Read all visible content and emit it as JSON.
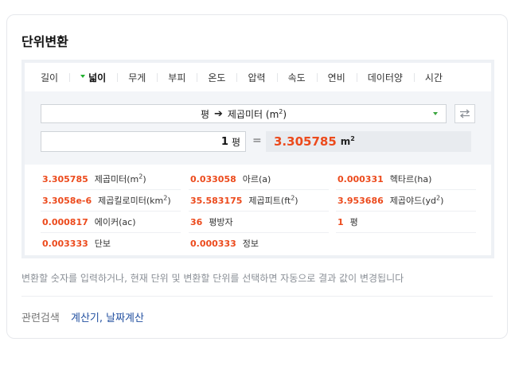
{
  "title": "단위변환",
  "tabs": [
    {
      "label": "길이"
    },
    {
      "label": "넓이",
      "active": true
    },
    {
      "label": "무게"
    },
    {
      "label": "부피"
    },
    {
      "label": "온도"
    },
    {
      "label": "압력"
    },
    {
      "label": "속도"
    },
    {
      "label": "연비"
    },
    {
      "label": "데이터양"
    },
    {
      "label": "시간"
    }
  ],
  "converter": {
    "from_unit": "평",
    "arrow": "➔",
    "to_unit_text": "제곱미터 (m",
    "to_unit_sup": "2",
    "to_unit_close": ")",
    "input_value": "1",
    "input_unit": "평",
    "equals": "=",
    "result_value": "3.305785",
    "result_unit": "m",
    "result_unit_sup": "2"
  },
  "results": [
    {
      "value": "3.305785",
      "name": "제곱미터(m",
      "sup": "2",
      "close": ")"
    },
    {
      "value": "0.033058",
      "name": "아르(a)"
    },
    {
      "value": "0.000331",
      "name": "헥타르(ha)"
    },
    {
      "value": "3.3058e-6",
      "name": "제곱킬로미터(km",
      "sup": "2",
      "close": ")"
    },
    {
      "value": "35.583175",
      "name": "제곱피트(ft",
      "sup": "2",
      "close": ")"
    },
    {
      "value": "3.953686",
      "name": "제곱야드(yd",
      "sup": "2",
      "close": ")"
    },
    {
      "value": "0.000817",
      "name": "에이커(ac)"
    },
    {
      "value": "36",
      "name": "평방자"
    },
    {
      "value": "1",
      "name": "평"
    },
    {
      "value": "0.003333",
      "name": "단보"
    },
    {
      "value": "0.000333",
      "name": "정보"
    }
  ],
  "help_text": "변환할 숫자를 입력하거나, 현재 단위 및 변환할 단위를 선택하면 자동으로 결과 값이 변경됩니다",
  "related": {
    "label": "관련검색",
    "links": [
      "계산기",
      "날짜계산"
    ],
    "sep": ", "
  },
  "colors": {
    "accent": "#ec4a1c",
    "link": "#2250a0",
    "green": "#20b02e"
  }
}
